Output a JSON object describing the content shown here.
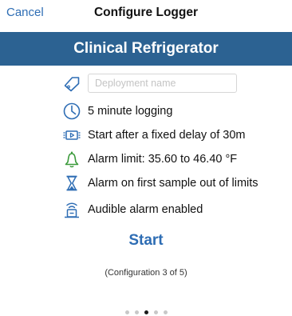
{
  "nav": {
    "cancel_label": "Cancel",
    "title": "Configure Logger"
  },
  "banner": {
    "title": "Clinical Refrigerator"
  },
  "deployment": {
    "placeholder": "Deployment name",
    "value": ""
  },
  "settings": [
    {
      "icon": "clock-icon",
      "label": "5 minute logging"
    },
    {
      "icon": "delayed-start-icon",
      "label": "Start after a fixed delay of 30m"
    },
    {
      "icon": "bell-icon",
      "label": "Alarm limit: 35.60 to 46.40 °F"
    },
    {
      "icon": "hourglass-icon",
      "label": "Alarm on first sample out of limits"
    },
    {
      "icon": "audible-alarm-icon",
      "label": "Audible alarm enabled"
    }
  ],
  "actions": {
    "start_label": "Start"
  },
  "config_note": "(Configuration 3 of 5)",
  "pager": {
    "total": 5,
    "current": 3
  },
  "colors": {
    "accent": "#2e6db4",
    "banner": "#2c6292",
    "bell": "#3a9a3a"
  }
}
